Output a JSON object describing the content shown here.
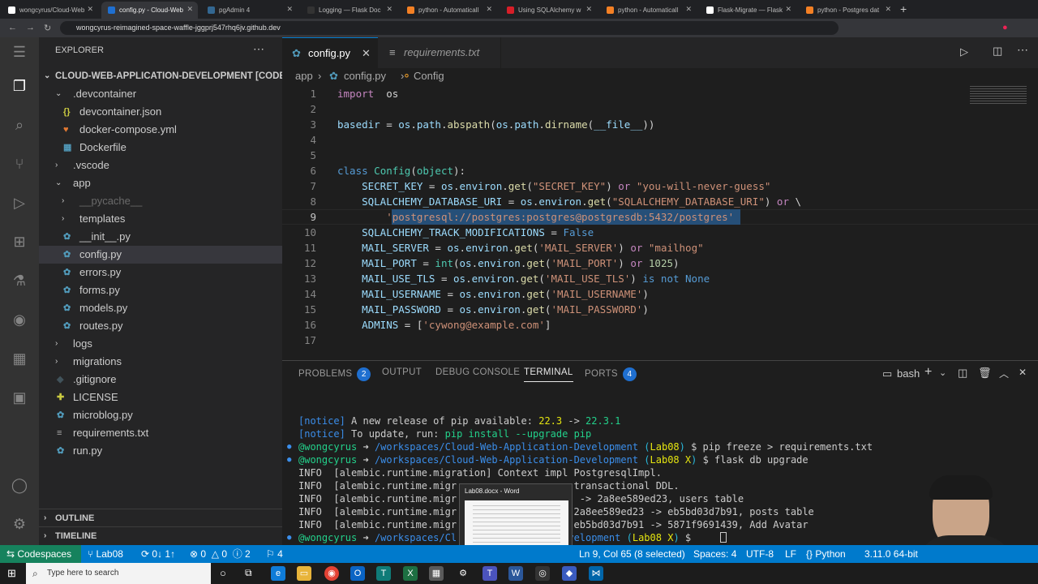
{
  "browser": {
    "tabs": [
      {
        "label": "wongcyrus/Cloud-Web",
        "color": "#ffffff"
      },
      {
        "label": "config.py - Cloud-Web",
        "color": "#1f6fd0",
        "active": true
      },
      {
        "label": "pgAdmin 4",
        "color": "#336791"
      },
      {
        "label": "Logging — Flask Doc",
        "color": "#333333"
      },
      {
        "label": "python - Automaticall",
        "color": "#f48024"
      },
      {
        "label": "Using SQLAlchemy w",
        "color": "#d71e28"
      },
      {
        "label": "python - Automaticall",
        "color": "#f48024"
      },
      {
        "label": "Flask-Migrate — Flask",
        "color": "#ffffff"
      },
      {
        "label": "python - Postgres dat",
        "color": "#f48024"
      }
    ],
    "url": "wongcyrus-reimagined-space-waffle-jggprj547rhq6jv.github.dev"
  },
  "sidebar": {
    "title": "EXPLORER",
    "root": "CLOUD-WEB-APPLICATION-DEVELOPMENT [CODES...",
    "items": [
      {
        "label": ".devcontainer",
        "type": "folder-open",
        "depth": 1
      },
      {
        "label": "devcontainer.json",
        "type": "json",
        "depth": 2
      },
      {
        "label": "docker-compose.yml",
        "type": "yml",
        "depth": 2
      },
      {
        "label": "Dockerfile",
        "type": "docker",
        "depth": 2
      },
      {
        "label": ".vscode",
        "type": "folder",
        "depth": 1
      },
      {
        "label": "app",
        "type": "folder-open",
        "depth": 1
      },
      {
        "label": "__pycache__",
        "type": "folder-dim",
        "depth": 2
      },
      {
        "label": "templates",
        "type": "folder",
        "depth": 2
      },
      {
        "label": "__init__.py",
        "type": "py",
        "depth": 2
      },
      {
        "label": "config.py",
        "type": "py",
        "depth": 2,
        "selected": true
      },
      {
        "label": "errors.py",
        "type": "py",
        "depth": 2
      },
      {
        "label": "forms.py",
        "type": "py",
        "depth": 2
      },
      {
        "label": "models.py",
        "type": "py",
        "depth": 2
      },
      {
        "label": "routes.py",
        "type": "py",
        "depth": 2
      },
      {
        "label": "logs",
        "type": "folder",
        "depth": 1
      },
      {
        "label": "migrations",
        "type": "folder",
        "depth": 1
      },
      {
        "label": ".gitignore",
        "type": "git",
        "depth": 1
      },
      {
        "label": "LICENSE",
        "type": "license",
        "depth": 1
      },
      {
        "label": "microblog.py",
        "type": "py",
        "depth": 1
      },
      {
        "label": "requirements.txt",
        "type": "txt",
        "depth": 1
      },
      {
        "label": "run.py",
        "type": "py",
        "depth": 1
      }
    ],
    "outline": "OUTLINE",
    "timeline": "TIMELINE"
  },
  "editor": {
    "tabs": [
      {
        "label": "config.py",
        "active": true
      },
      {
        "label": "requirements.txt",
        "active": false
      }
    ],
    "breadcrumb": [
      "app",
      "config.py",
      "Config"
    ],
    "line_numbers": [
      "1",
      "2",
      "3",
      "4",
      "5",
      "6",
      "7",
      "8",
      "9",
      "10",
      "11",
      "12",
      "13",
      "14",
      "15",
      "16",
      "17"
    ],
    "code": [
      [
        [
          "kw",
          "import"
        ],
        [
          "",
          "  "
        ],
        [
          "",
          "os"
        ]
      ],
      [],
      [
        [
          "vr",
          "basedir"
        ],
        [
          "d",
          " = "
        ],
        [
          "vr",
          "os"
        ],
        [
          "d",
          "."
        ],
        [
          "vr",
          "path"
        ],
        [
          "d",
          "."
        ],
        [
          "fn",
          "abspath"
        ],
        [
          "d",
          "("
        ],
        [
          "vr",
          "os"
        ],
        [
          "d",
          "."
        ],
        [
          "vr",
          "path"
        ],
        [
          "d",
          "."
        ],
        [
          "fn",
          "dirname"
        ],
        [
          "d",
          "("
        ],
        [
          "vr",
          "__file__"
        ],
        [
          "d",
          "))"
        ]
      ],
      [],
      [],
      [
        [
          "kb",
          "class"
        ],
        [
          "d",
          " "
        ],
        [
          "cls",
          "Config"
        ],
        [
          "d",
          "("
        ],
        [
          "cls",
          "object"
        ],
        [
          "d",
          "):"
        ]
      ],
      [
        [
          "d",
          "    "
        ],
        [
          "vr",
          "SECRET_KEY"
        ],
        [
          "d",
          " = "
        ],
        [
          "vr",
          "os"
        ],
        [
          "d",
          "."
        ],
        [
          "vr",
          "environ"
        ],
        [
          "d",
          "."
        ],
        [
          "fn",
          "get"
        ],
        [
          "d",
          "("
        ],
        [
          "st",
          "\"SECRET_KEY\""
        ],
        [
          "d",
          ") "
        ],
        [
          "kw",
          "or"
        ],
        [
          "d",
          " "
        ],
        [
          "st",
          "\"you-will-never-guess\""
        ]
      ],
      [
        [
          "d",
          "    "
        ],
        [
          "vr",
          "SQLALCHEMY_DATABASE_URI"
        ],
        [
          "d",
          " = "
        ],
        [
          "vr",
          "os"
        ],
        [
          "d",
          "."
        ],
        [
          "vr",
          "environ"
        ],
        [
          "d",
          "."
        ],
        [
          "fn",
          "get"
        ],
        [
          "d",
          "("
        ],
        [
          "st",
          "\"SQLALCHEMY_DATABASE_URI\""
        ],
        [
          "d",
          ") "
        ],
        [
          "kw",
          "or"
        ],
        [
          "d",
          " \\"
        ]
      ],
      [
        [
          "d",
          "        "
        ],
        [
          "st",
          "'postgresql://postgres:postgres@postgresdb:5432/postgres'"
        ]
      ],
      [
        [
          "d",
          "    "
        ],
        [
          "vr",
          "SQLALCHEMY_TRACK_MODIFICATIONS"
        ],
        [
          "d",
          " = "
        ],
        [
          "kb",
          "False"
        ]
      ],
      [
        [
          "d",
          "    "
        ],
        [
          "vr",
          "MAIL_SERVER"
        ],
        [
          "d",
          " = "
        ],
        [
          "vr",
          "os"
        ],
        [
          "d",
          "."
        ],
        [
          "vr",
          "environ"
        ],
        [
          "d",
          "."
        ],
        [
          "fn",
          "get"
        ],
        [
          "d",
          "("
        ],
        [
          "st",
          "'MAIL_SERVER'"
        ],
        [
          "d",
          ") "
        ],
        [
          "kw",
          "or"
        ],
        [
          "d",
          " "
        ],
        [
          "st",
          "\"mailhog\""
        ]
      ],
      [
        [
          "d",
          "    "
        ],
        [
          "vr",
          "MAIL_PORT"
        ],
        [
          "d",
          " = "
        ],
        [
          "cls",
          "int"
        ],
        [
          "d",
          "("
        ],
        [
          "vr",
          "os"
        ],
        [
          "d",
          "."
        ],
        [
          "vr",
          "environ"
        ],
        [
          "d",
          "."
        ],
        [
          "fn",
          "get"
        ],
        [
          "d",
          "("
        ],
        [
          "st",
          "'MAIL_PORT'"
        ],
        [
          "d",
          ") "
        ],
        [
          "kw",
          "or"
        ],
        [
          "d",
          " "
        ],
        [
          "num",
          "1025"
        ],
        [
          "d",
          ")"
        ]
      ],
      [
        [
          "d",
          "    "
        ],
        [
          "vr",
          "MAIL_USE_TLS"
        ],
        [
          "d",
          " = "
        ],
        [
          "vr",
          "os"
        ],
        [
          "d",
          "."
        ],
        [
          "vr",
          "environ"
        ],
        [
          "d",
          "."
        ],
        [
          "fn",
          "get"
        ],
        [
          "d",
          "("
        ],
        [
          "st",
          "'MAIL_USE_TLS'"
        ],
        [
          "d",
          ") "
        ],
        [
          "kb",
          "is not"
        ],
        [
          "d",
          " "
        ],
        [
          "kb",
          "None"
        ]
      ],
      [
        [
          "d",
          "    "
        ],
        [
          "vr",
          "MAIL_USERNAME"
        ],
        [
          "d",
          " = "
        ],
        [
          "vr",
          "os"
        ],
        [
          "d",
          "."
        ],
        [
          "vr",
          "environ"
        ],
        [
          "d",
          "."
        ],
        [
          "fn",
          "get"
        ],
        [
          "d",
          "("
        ],
        [
          "st",
          "'MAIL_USERNAME'"
        ],
        [
          "d",
          ")"
        ]
      ],
      [
        [
          "d",
          "    "
        ],
        [
          "vr",
          "MAIL_PASSWORD"
        ],
        [
          "d",
          " = "
        ],
        [
          "vr",
          "os"
        ],
        [
          "d",
          "."
        ],
        [
          "vr",
          "environ"
        ],
        [
          "d",
          "."
        ],
        [
          "fn",
          "get"
        ],
        [
          "d",
          "("
        ],
        [
          "st",
          "'MAIL_PASSWORD'"
        ],
        [
          "d",
          ")"
        ]
      ],
      [
        [
          "d",
          "    "
        ],
        [
          "vr",
          "ADMINS"
        ],
        [
          "d",
          " = ["
        ],
        [
          "st",
          "'cywong@example.com'"
        ],
        [
          "d",
          "]"
        ]
      ],
      []
    ]
  },
  "panel": {
    "tabs": [
      {
        "label": "PROBLEMS",
        "badge": "2"
      },
      {
        "label": "OUTPUT"
      },
      {
        "label": "DEBUG CONSOLE"
      },
      {
        "label": "TERMINAL",
        "active": true
      },
      {
        "label": "PORTS",
        "badge": "4"
      }
    ],
    "shell": "bash",
    "terminal": [
      [
        [
          "tb",
          "[notice]"
        ],
        [
          "t",
          " A new release of pip available: "
        ],
        [
          "tr",
          "22.3"
        ],
        [
          "t",
          " -> "
        ],
        [
          "tg",
          "22.3.1"
        ]
      ],
      [
        [
          "tb",
          "[notice]"
        ],
        [
          "t",
          " To update, run: "
        ],
        [
          "tg",
          "pip install --upgrade pip"
        ]
      ],
      [
        [
          "tg",
          "@wongcyrus "
        ],
        [
          "t",
          "➜ "
        ],
        [
          "tb",
          "/workspaces/Cloud-Web-Application-Development "
        ],
        [
          "tc",
          "("
        ],
        [
          "tr",
          "Lab08"
        ],
        [
          "tc",
          ")"
        ],
        [
          "t",
          " $ pip freeze > requirements.txt"
        ]
      ],
      [
        [
          "tg",
          "@wongcyrus "
        ],
        [
          "t",
          "➜ "
        ],
        [
          "tb",
          "/workspaces/Cloud-Web-Application-Development "
        ],
        [
          "tc",
          "("
        ],
        [
          "tr",
          "Lab08 "
        ],
        [
          "ty",
          "X"
        ],
        [
          "tc",
          ")"
        ],
        [
          "t",
          " $ flask db upgrade"
        ]
      ],
      [
        [
          "t",
          "INFO  [alembic.runtime.migration] Context impl PostgresqlImpl."
        ]
      ],
      [
        [
          "t",
          "INFO  [alembic.runtime.migr                    transactional DDL."
        ]
      ],
      [
        [
          "t",
          "INFO  [alembic.runtime.migr                ade  -> 2a8ee589ed23, users table"
        ]
      ],
      [
        [
          "t",
          "INFO  [alembic.runtime.migr                ade 2a8ee589ed23 -> eb5bd03d7b91, posts table"
        ]
      ],
      [
        [
          "t",
          "INFO  [alembic.runtime.migr                ade eb5bd03d7b91 -> 5871f9691439, Add Avatar"
        ]
      ],
      [
        [
          "tg",
          "@wongcyrus "
        ],
        [
          "t",
          "➜ "
        ],
        [
          "tb",
          "/workspaces/Cl                -Development "
        ],
        [
          "tc",
          "("
        ],
        [
          "tr",
          "Lab08 "
        ],
        [
          "ty",
          "X"
        ],
        [
          "tc",
          ")"
        ],
        [
          "t",
          " $ "
        ]
      ]
    ]
  },
  "statusbar": {
    "remote": "Codespaces",
    "branch": "Lab08",
    "sync": "0↓ 1↑",
    "errors": "0",
    "warnings": "0",
    "info": "2",
    "ports": "4",
    "cursor": "Ln 9, Col 65 (8 selected)",
    "spaces": "Spaces: 4",
    "encoding": "UTF-8",
    "eol": "LF",
    "language": "Python",
    "interpreter": "3.11.0 64-bit"
  },
  "popup": {
    "title": "Lab08.docx - Word"
  },
  "taskbar": {
    "search_placeholder": "Type here to search"
  }
}
